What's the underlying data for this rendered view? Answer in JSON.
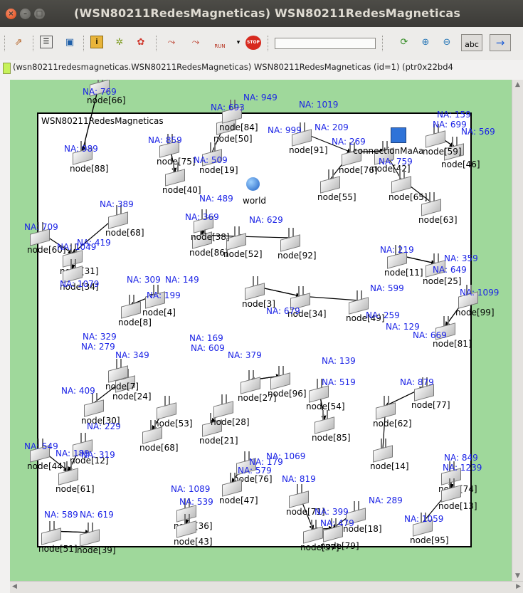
{
  "window": {
    "title": "(WSN80211RedesMagneticas) WSN80211RedesMagneticas"
  },
  "toolbar": {
    "icons": [
      "back-icon",
      "list-icon",
      "monitor-icon",
      "info-icon",
      "network-icon",
      "colors-icon",
      "step-icon",
      "run-icon",
      "fast-run-icon",
      "dropdown-icon",
      "stop-icon",
      "speed-slider",
      "refresh-icon",
      "zoom-in-icon",
      "zoom-out-icon",
      "abc-icon",
      "arrow-right-icon"
    ],
    "run_label": "RUN",
    "stop_label": "STOP",
    "abc_label": "abc"
  },
  "infobar": {
    "text": "(wsn80211redesmagneticas.WSN80211RedesMagneticas) WSN80211RedesMagneticas  (id=1)  (ptr0x22bd4"
  },
  "network": {
    "title": "WSN80211RedesMagneticas",
    "world_label": "world",
    "connection_label": "connectionMaAa",
    "node_labels": [
      "node[66]",
      "node[88]",
      "node[75]",
      "node[19]",
      "node[40]",
      "node[50]",
      "node[84]",
      "node[91]",
      "node[76]",
      "node[42]",
      "node[65]",
      "node[46]",
      "node[59]",
      "node[55]",
      "node[63]",
      "node[68]",
      "node[60]",
      "node[31]",
      "node[34]",
      "node[86]",
      "node[52]",
      "node[38]",
      "node[92]",
      "node[11]",
      "node[25]",
      "node[99]",
      "node[4]",
      "node[8]",
      "node[34]",
      "node[49]",
      "node[81]",
      "node[77]",
      "node[62]",
      "node[14]",
      "node[24]",
      "node[30]",
      "node[53]",
      "node[68]",
      "node[21]",
      "node[28]",
      "node[96]",
      "node[85]",
      "node[44]",
      "node[12]",
      "node[61]",
      "node[76]",
      "node[47]",
      "node[71]",
      "node[18]",
      "node[37]",
      "node[79]",
      "node[95]",
      "node[74]",
      "node[13]",
      "node[36]",
      "node[43]",
      "node[51]",
      "node[39]",
      "node[27]",
      "node[54]",
      "node[7]",
      "node[3]"
    ],
    "na_labels": [
      "NA: 769",
      "NA: 949",
      "NA: 693",
      "NA: 1019",
      "NA: 989",
      "NA: 859",
      "NA: 999",
      "NA: 209",
      "NA: 269",
      "NA: 159",
      "NA: 699",
      "NA: 569",
      "NA: 509",
      "NA: 759",
      "NA: 489",
      "NA: 389",
      "NA: 369",
      "NA: 629",
      "NA: 709",
      "NA: 419",
      "NA: 1049",
      "NA: 219",
      "NA: 359",
      "NA: 649",
      "NA: 1079",
      "NA: 309",
      "NA: 149",
      "NA: 199",
      "NA: 599",
      "NA: 1099",
      "NA: 679",
      "NA: 259",
      "NA: 129",
      "NA: 669",
      "NA: 329",
      "NA: 279",
      "NA: 169",
      "NA: 609",
      "NA: 379",
      "NA: 349",
      "NA: 139",
      "NA: 519",
      "NA: 879",
      "NA: 409",
      "NA: 229",
      "NA: 549",
      "NA: 189",
      "NA: 319",
      "NA: 1069",
      "NA: 179",
      "NA: 579",
      "NA: 819",
      "NA: 849",
      "NA: 1239",
      "NA: 1089",
      "NA: 539",
      "NA: 289",
      "NA: 399",
      "NA: 479",
      "NA: 589",
      "NA: 619",
      "NA: 1059"
    ]
  }
}
